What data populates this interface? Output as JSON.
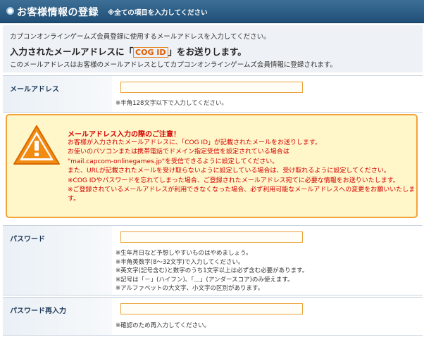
{
  "header": {
    "title": "お客様情報の登録",
    "note": "※全ての項目を入力してください",
    "icon": "circle-bullet-icon"
  },
  "intro": {
    "line1": "カプコンオンラインゲームズ会員登録に使用するメールアドレスを入力してください。",
    "lead_before": "入力されたメールアドレスに「",
    "lead_cog": "COG ID",
    "lead_after": "」をお送りします。",
    "line2": "このメールアドレスはお客様のメールアドレスとしてカプコンオンラインゲームズ会員情報に登録されます。"
  },
  "email": {
    "label": "メールアドレス",
    "value": "",
    "hint": "※半角128文字以下で入力してください。"
  },
  "warning": {
    "icon": "warning-triangle-icon",
    "title": "メールアドレス入力の際のご注意！",
    "lines": [
      "お客様が入力されたメールアドレスに、「COG ID」が記載されたメールをお送りします。",
      "お使いのパソコンまたは携帯電話でドメイン指定受信を設定されている場合は",
      "\"mail.capcom-onlinegames.jp\"を受信できるように設定してください。",
      "また、URLが記載されたメールを受け取らないように設定している場合は、受け取れるように設定してください。",
      "※COG IDやパスワードを忘れてしまった場合、ご登録されたメールアドレス宛てに必要な情報をお送りいたします。",
      "※ご登録されているメールアドレスが利用できなくなった場合、必ず利用可能なメールアドレスへの変更をお願いいたしま",
      "す。"
    ]
  },
  "password": {
    "label": "パスワード",
    "value": "",
    "hints": [
      "※生年月日など予想しやすいものはやめましょう。",
      "※半角英数字(8～32文字)で入力してください。",
      "※英文字(記号含む)と数字のうち1文字以上は必ず含む必要があります。",
      "※記号は「－」(ハイフン)、「＿」(アンダースコア)のみ使えます。",
      "※アルファベットの大文字、小文字の区別があります。"
    ]
  },
  "password_confirm": {
    "label": "パスワード再入力",
    "value": "",
    "hint": "※確認のため再入力してください。"
  },
  "colors": {
    "header_bg": "#2b5a82",
    "field_border": "#e8a33c",
    "warn_border": "#f2a23a",
    "warn_bg": "#fff7c9",
    "warn_text": "#d40000"
  }
}
